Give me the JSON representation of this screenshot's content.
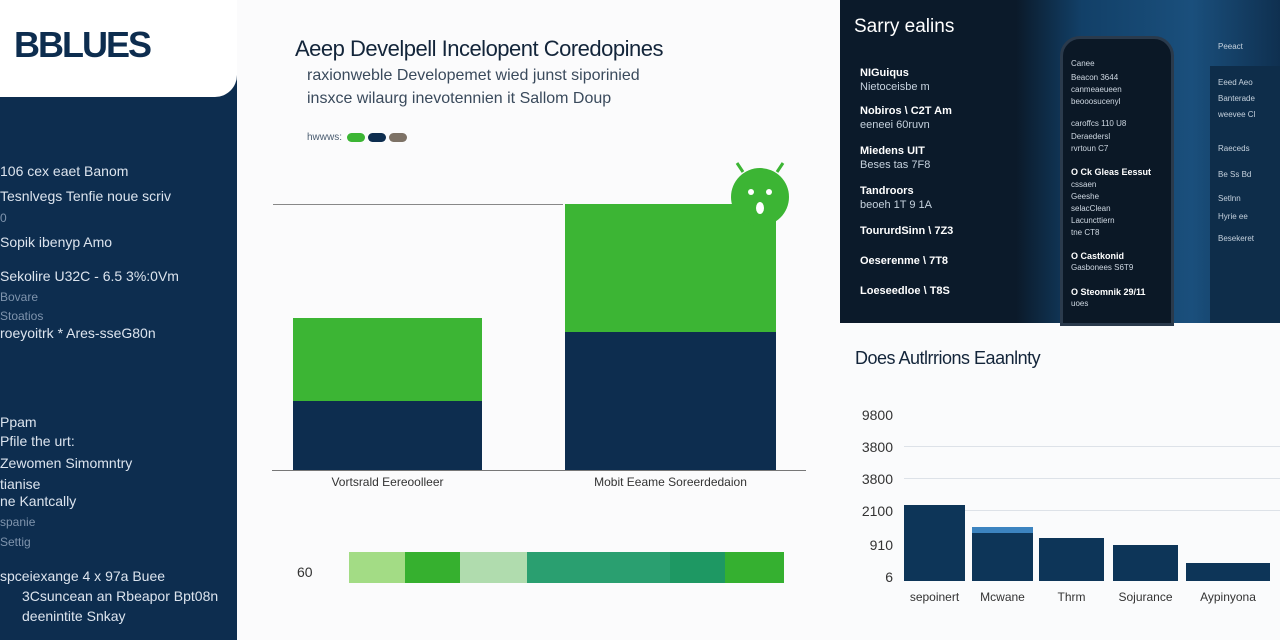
{
  "sidebar": {
    "logo": "BBLUES",
    "lines": [
      "106 cex eaet Banom",
      "Tesnlvegs Tenfie noue scriv",
      "0",
      "Sopik ibenyp Amo",
      "Sekolire U32C - 6.5 3%:0Vm",
      "Bovare",
      "Stoatios",
      "roeyoitrk * Ares-sseG80n",
      "Ppam",
      "Pfile the urt:",
      "Zewomen Simomntry",
      "tianise",
      "ne Kantcally",
      "spanie",
      "Settig",
      "spceiexange 4 x 97a Buee",
      "3Csuncean an Rbeapor Bpt08n",
      "deenintite Snkay"
    ]
  },
  "main": {
    "title": "Aeep Develpell Incelopent Coredopines",
    "subtitle_1": "raxionweble Developemet wied junst siporinied",
    "subtitle_2": "insxce wilaurg inevotennien it Sallom Doup",
    "legend_label": "hwwws:",
    "colors": {
      "green": "#3cb534",
      "navy": "#0d2d4f",
      "taupe": "#7d7266"
    },
    "android_icon": "android-icon",
    "progress_label": "60",
    "progress_segments": [
      "#a3dc85",
      "#36b02f",
      "#b0dcae",
      "#2a9f70",
      "#1e9863",
      "#35b030"
    ]
  },
  "chart_data": [
    {
      "type": "bar",
      "stacked": true,
      "categories": [
        "Vortsrald Eereoolleer",
        "Mobit Eeame Soreerdedaion"
      ],
      "series": [
        {
          "color": "#0d2d4f",
          "values": [
            26,
            52
          ]
        },
        {
          "color": "#3cb534",
          "values": [
            31,
            48
          ]
        }
      ],
      "ylim": [
        0,
        100
      ],
      "grid": false
    },
    {
      "type": "bar",
      "title": "Does Autlrrions Eaanlnty",
      "categories": [
        "sepoinert",
        "Mcwane",
        "Thrm",
        "Sojurance",
        "Aypinyona"
      ],
      "values": [
        2400,
        1550,
        1150,
        920,
        400
      ],
      "yticks": [
        "9800",
        "3800",
        "3800",
        "2100",
        "910",
        "6"
      ],
      "color": "#0d3558",
      "grid": true
    }
  ],
  "dark_panel": {
    "title": "Sarry ealins",
    "items": [
      {
        "head": "NIGuiqus",
        "sub": "Nietoceisbe m"
      },
      {
        "head": "Nobiros \\ C2T Am",
        "sub": "eeneei 60ruvn"
      },
      {
        "head": "Miedens UIT",
        "sub": "Beses tas 7F8"
      },
      {
        "head": "Tandroors",
        "sub": "beoeh 1T 9 1A"
      },
      {
        "head": "ToururdSinn \\ 7Z3",
        "sub": ""
      },
      {
        "head": "Oeserenme \\ 7T8",
        "sub": ""
      },
      {
        "head": "Loeseedloe \\ T8S",
        "sub": ""
      }
    ],
    "phone_lines": [
      {
        "t": "Canee",
        "hd": false
      },
      {
        "t": "Beacon 3644",
        "hd": false
      },
      {
        "t": "canmeaeueen",
        "hd": false
      },
      {
        "t": "beooosucenyl",
        "hd": false
      },
      {
        "t": "caroffcs 110 U8",
        "hd": false
      },
      {
        "t": "Deraedersl",
        "hd": false
      },
      {
        "t": "rvrtoun C7",
        "hd": false
      },
      {
        "t": "O Ck Gleas Eessut",
        "hd": true
      },
      {
        "t": "cssaen",
        "hd": false
      },
      {
        "t": "Geeshe",
        "hd": false
      },
      {
        "t": "selacClean",
        "hd": false
      },
      {
        "t": "Lacuncttiern",
        "hd": false
      },
      {
        "t": "tne CT8",
        "hd": false
      },
      {
        "t": "O Castkonid",
        "hd": true
      },
      {
        "t": "Gasbonees S6T9",
        "hd": false
      },
      {
        "t": "O Steomnik 29/11",
        "hd": true
      },
      {
        "t": "uoes",
        "hd": false
      }
    ],
    "side_lines": [
      "Peeact",
      "Eeed Aeo",
      "Banterade",
      "weevee Cl",
      "Raeceds",
      "Be Ss Bd",
      "Setlnn",
      "Hyrie ee",
      "Besekeret"
    ]
  }
}
